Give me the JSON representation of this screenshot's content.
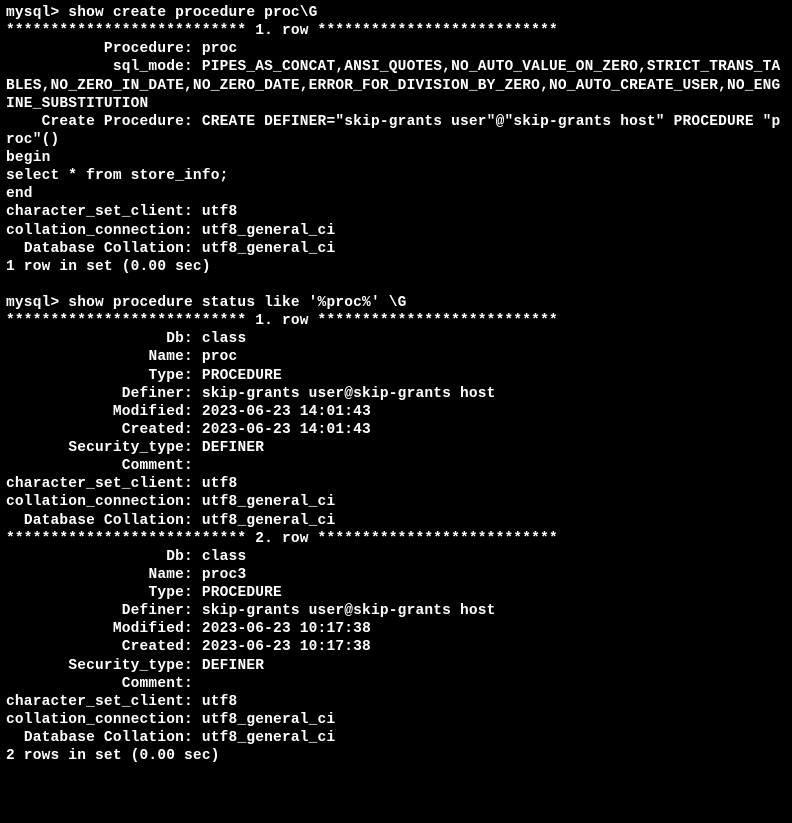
{
  "block1": {
    "command": "mysql> show create procedure proc\\G",
    "rowSep": "*************************** 1. row ***************************",
    "lines": [
      "           Procedure: proc",
      "            sql_mode: PIPES_AS_CONCAT,ANSI_QUOTES,NO_AUTO_VALUE_ON_ZERO,STRICT_TRANS_TABLES,NO_ZERO_IN_DATE,NO_ZERO_DATE,ERROR_FOR_DIVISION_BY_ZERO,NO_AUTO_CREATE_USER,NO_ENGINE_SUBSTITUTION",
      "    Create Procedure: CREATE DEFINER=\"skip-grants user\"@\"skip-grants host\" PROCEDURE \"proc\"()",
      "begin",
      "select * from store_info;",
      "end",
      "character_set_client: utf8",
      "collation_connection: utf8_general_ci",
      "  Database Collation: utf8_general_ci",
      "1 row in set (0.00 sec)"
    ]
  },
  "block2": {
    "command": "mysql> show procedure status like '%proc%' \\G",
    "row1Sep": "*************************** 1. row ***************************",
    "row1": [
      "                  Db: class",
      "                Name: proc",
      "                Type: PROCEDURE",
      "             Definer: skip-grants user@skip-grants host",
      "            Modified: 2023-06-23 14:01:43",
      "             Created: 2023-06-23 14:01:43",
      "       Security_type: DEFINER",
      "             Comment:",
      "character_set_client: utf8",
      "collation_connection: utf8_general_ci",
      "  Database Collation: utf8_general_ci"
    ],
    "row2Sep": "*************************** 2. row ***************************",
    "row2": [
      "                  Db: class",
      "                Name: proc3",
      "                Type: PROCEDURE",
      "             Definer: skip-grants user@skip-grants host",
      "            Modified: 2023-06-23 10:17:38",
      "             Created: 2023-06-23 10:17:38",
      "       Security_type: DEFINER",
      "             Comment:",
      "character_set_client: utf8",
      "collation_connection: utf8_general_ci",
      "  Database Collation: utf8_general_ci",
      "2 rows in set (0.00 sec)"
    ]
  }
}
